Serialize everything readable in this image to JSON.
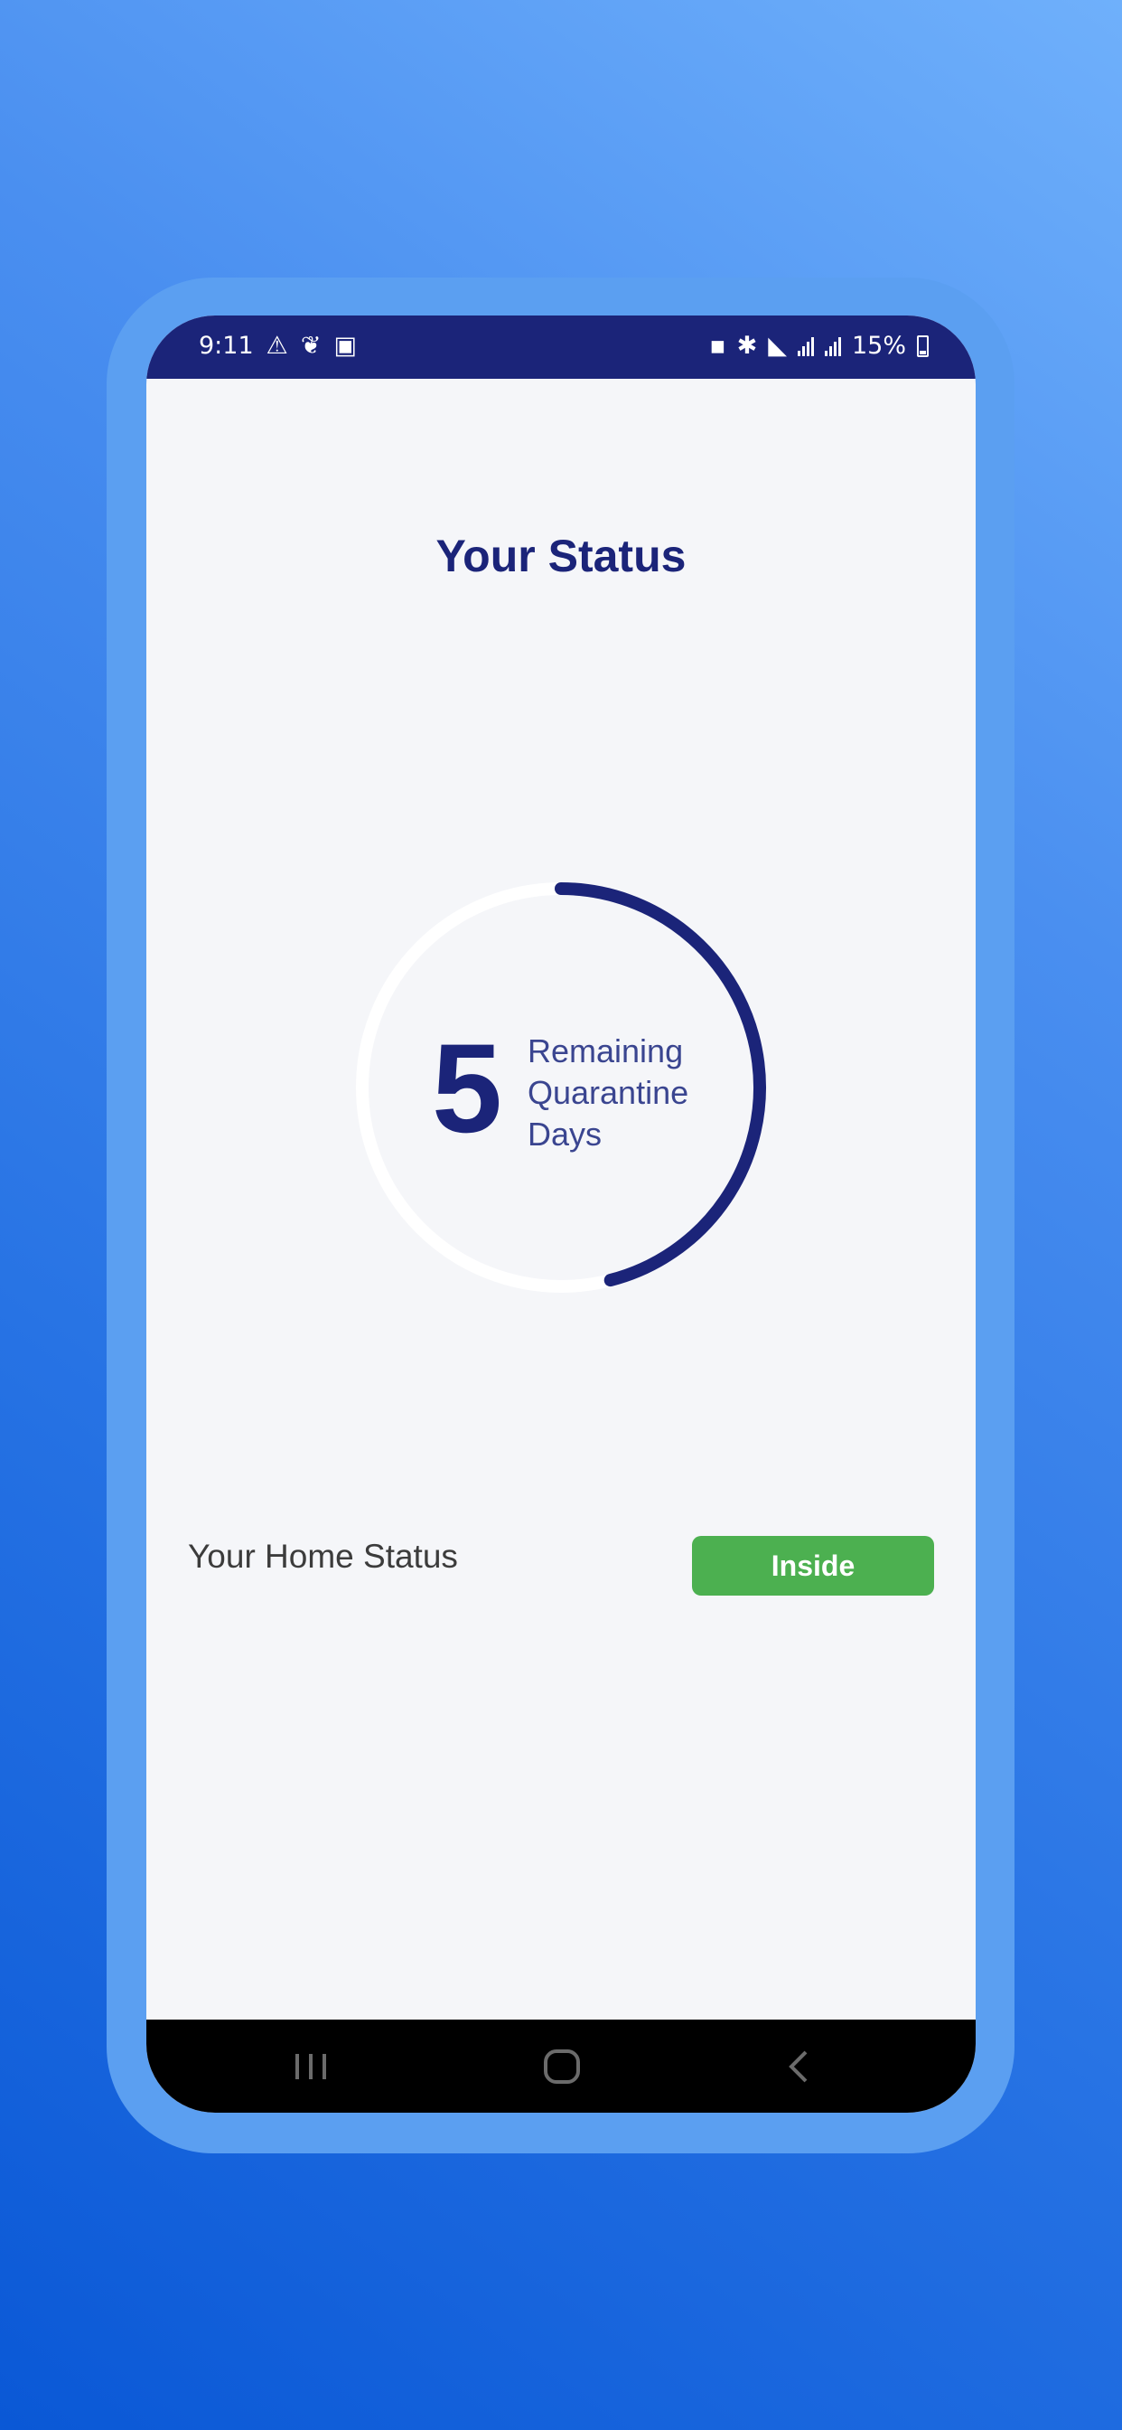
{
  "status_bar": {
    "time": "9:11",
    "left_icons": [
      "notification-icon",
      "leaf-icon",
      "image-icon"
    ],
    "right_icons": [
      "lock-icon",
      "bluetooth-icon",
      "mute-icon",
      "4g-signal-icon",
      "volte-signal-icon"
    ],
    "battery": "15%"
  },
  "screen": {
    "title": "Your Status",
    "countdown": {
      "value": "5",
      "label_lines": [
        "Remaining",
        "Quarantine",
        "Days"
      ],
      "progress_fraction": 0.46
    },
    "home_status": {
      "label": "Your Home Status",
      "badge": "Inside"
    }
  },
  "nav_bar": {
    "buttons": [
      "recent-apps",
      "home",
      "back"
    ]
  },
  "colors": {
    "primary": "#1b2479",
    "track": "#ffffff",
    "success": "#4cb050",
    "frame": "#5b9ff1"
  }
}
